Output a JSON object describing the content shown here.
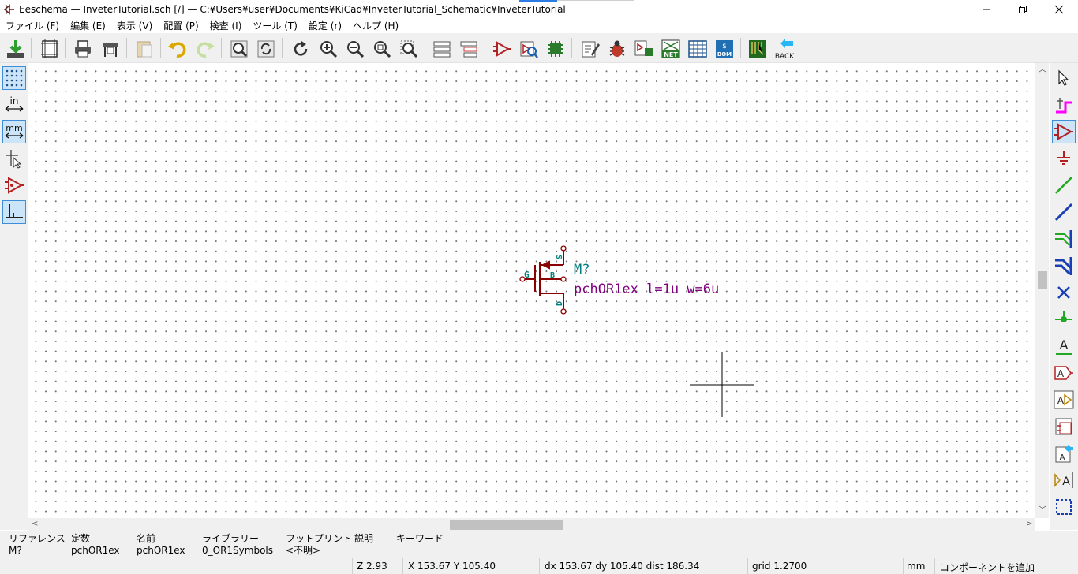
{
  "window": {
    "title": "Eeschema — InveterTutorial.sch [/] — C:¥Users¥user¥Documents¥KiCad¥InveterTutorial_Schematic¥InveterTutorial"
  },
  "menu": {
    "items": [
      {
        "label": "ファイル (F)"
      },
      {
        "label": "編集 (E)"
      },
      {
        "label": "表示 (V)"
      },
      {
        "label": "配置 (P)"
      },
      {
        "label": "検査 (I)"
      },
      {
        "label": "ツール (T)"
      },
      {
        "label": "設定 (r)"
      },
      {
        "label": "ヘルプ (H)"
      }
    ]
  },
  "toolbar": {
    "back_label": "BACK",
    "net_label": "NET",
    "bom_label": "BOM"
  },
  "lefttoolbar": {
    "units_in_label": "in",
    "units_mm_label": "mm"
  },
  "righttoolbar": {
    "text_label": "A"
  },
  "schematic": {
    "component": {
      "reference": "M?",
      "value": "pchOR1ex l=1u w=6u",
      "pin_g": "G",
      "pin_b": "B",
      "pin_s": "S",
      "pin_d": "D"
    },
    "colors": {
      "symbol_body": "#8b0000",
      "reference_text": "#008080",
      "value_text": "#800080",
      "pin_name": "#008080"
    }
  },
  "infopanel": {
    "columns": [
      {
        "header": "リファレンス",
        "value": "M?"
      },
      {
        "header": "定数",
        "value": "pchOR1ex"
      },
      {
        "header": "名前",
        "value": "pchOR1ex"
      },
      {
        "header": "ライブラリー",
        "value": "0_OR1Symbols"
      },
      {
        "header": "フットプリント",
        "value": "<不明>"
      },
      {
        "header": "説明",
        "value": ""
      },
      {
        "header": "キーワード",
        "value": ""
      }
    ]
  },
  "statusbar": {
    "zoom": "Z 2.93",
    "cursor": "X 153.67  Y 105.40",
    "delta": "dx 153.67  dy 105.40  dist 186.34",
    "grid": "grid 1.2700",
    "units": "mm",
    "mode": "コンポーネントを追加"
  }
}
